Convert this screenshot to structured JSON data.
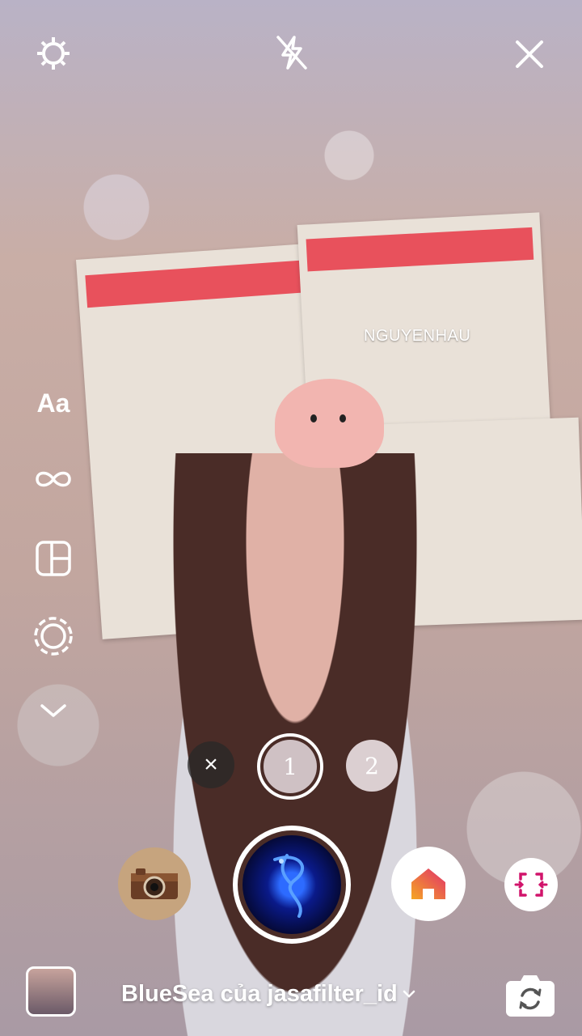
{
  "watermark": "NGUYENHAU",
  "side_tools": {
    "create_label": "Aa"
  },
  "segments": {
    "current": "1",
    "next": "2",
    "delete_symbol": "×"
  },
  "effect": {
    "name": "BlueSea của jasafilter_id"
  },
  "colors": {
    "home_gradient_start": "#f5a623",
    "home_gradient_end": "#e1306c",
    "scan_accent": "#d1146b"
  }
}
